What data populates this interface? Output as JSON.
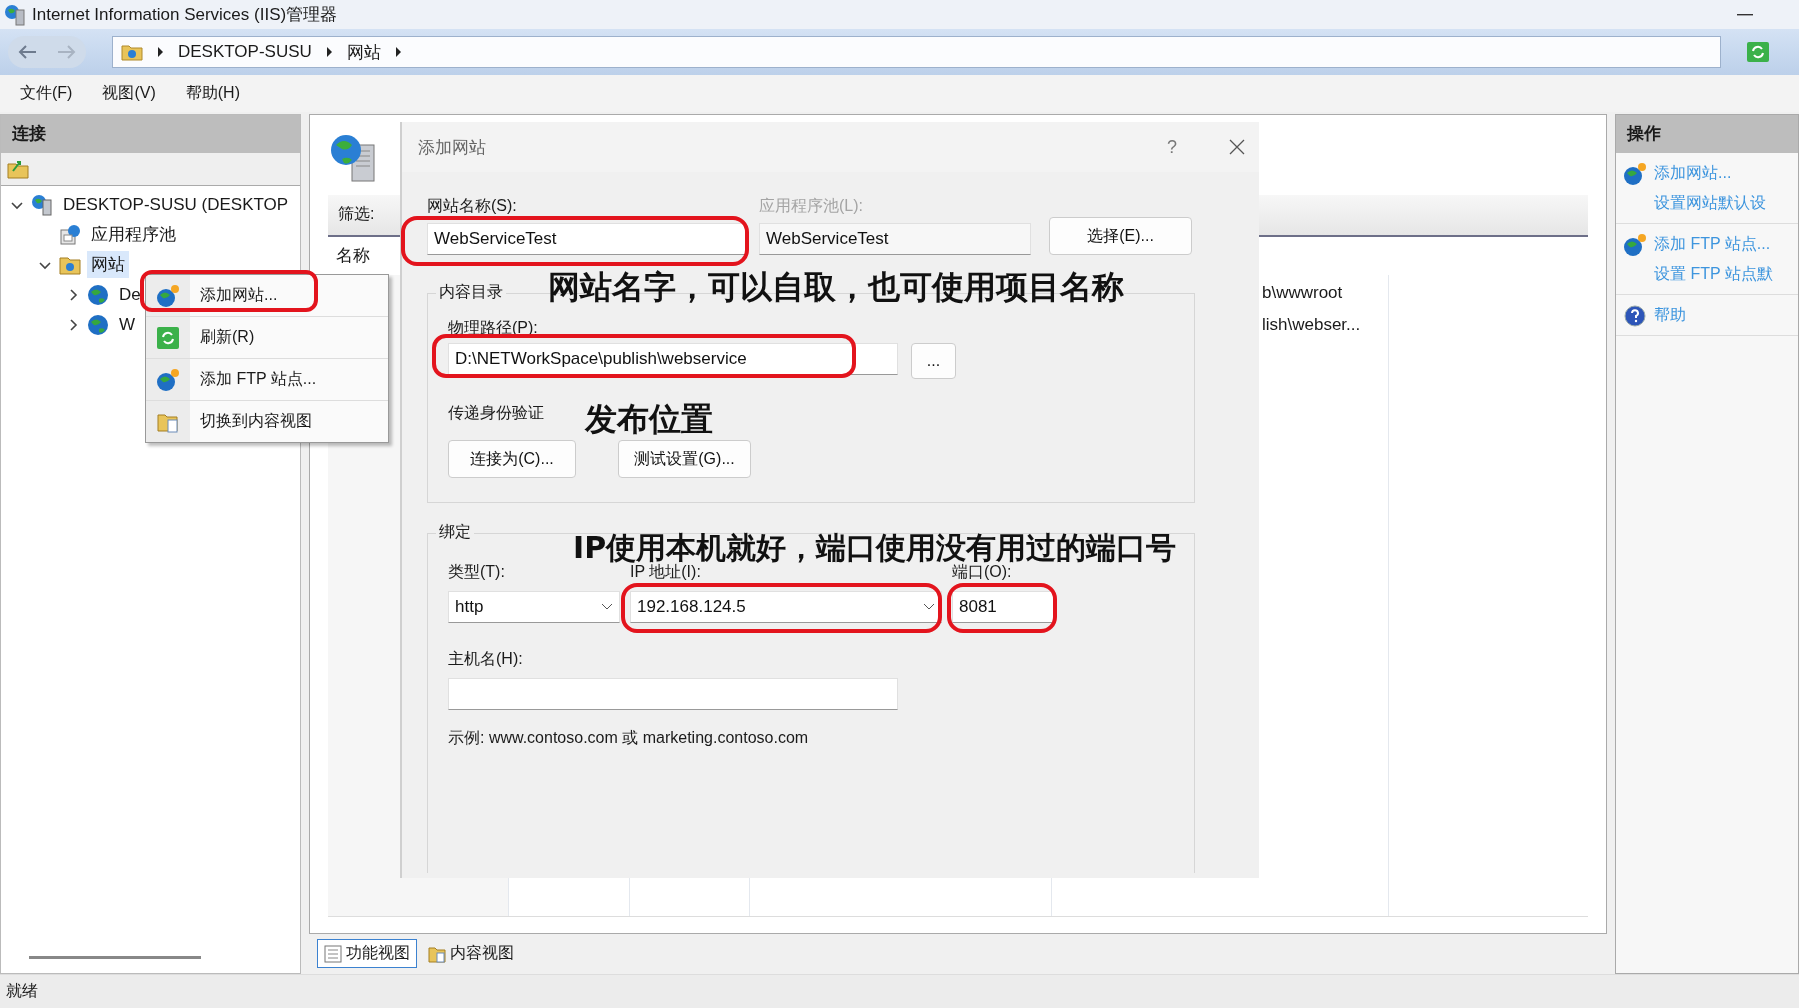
{
  "window": {
    "title": "Internet Information Services (IIS)管理器"
  },
  "breadcrumb": [
    "DESKTOP-SUSU",
    "网站"
  ],
  "menu": [
    "文件(F)",
    "视图(V)",
    "帮助(H)"
  ],
  "connections": {
    "title": "连接",
    "tree": [
      {
        "label": "DESKTOP-SUSU (DESKTOP",
        "kind": "server",
        "expanded": true,
        "selected": false,
        "children": [
          {
            "label": "应用程序池",
            "kind": "pool",
            "selected": false
          },
          {
            "label": "网站",
            "kind": "sites",
            "expanded": true,
            "selected": true,
            "children": [
              {
                "label": "De",
                "kind": "site",
                "expanded": false,
                "selected": false
              },
              {
                "label": "W",
                "kind": "site",
                "expanded": false,
                "selected": false
              }
            ]
          }
        ]
      }
    ]
  },
  "content": {
    "filter_label": "筛选:",
    "column_header": "名称",
    "rows": [
      {
        "path": "b\\wwwroot"
      },
      {
        "path": "lish\\webser..."
      }
    ],
    "views": [
      {
        "label": "功能视图",
        "selected": true
      },
      {
        "label": "内容视图",
        "selected": false
      }
    ]
  },
  "context_menu": [
    {
      "label": "添加网站...",
      "kind": "add"
    },
    {
      "label": "刷新(R)",
      "kind": "refresh"
    },
    {
      "label": "添加 FTP 站点...",
      "kind": "add"
    },
    {
      "label": "切换到内容视图",
      "kind": "view"
    }
  ],
  "actions": {
    "title": "操作",
    "groups": [
      [
        {
          "label": "添加网站...",
          "kind": "add"
        },
        {
          "label": "设置网站默认设",
          "kind": "plain"
        }
      ],
      [
        {
          "label": "添加 FTP 站点...",
          "kind": "add"
        },
        {
          "label": "设置 FTP 站点默",
          "kind": "plain"
        }
      ],
      [
        {
          "label": "帮助",
          "kind": "help"
        }
      ]
    ]
  },
  "dialog": {
    "title": "添加网站",
    "help": "?",
    "site_name": {
      "label": "网站名称(S):",
      "value": "WebServiceTest"
    },
    "app_pool": {
      "label": "应用程序池(L):",
      "value": "WebServiceTest",
      "disabled": true
    },
    "select_button": "选择(E)...",
    "content_dir": {
      "legend": "内容目录",
      "path_label": "物理路径(P):",
      "path_value": "D:\\NETWorkSpace\\publish\\webservice",
      "browse_button": "...",
      "auth_label": "传递身份验证",
      "buttons": [
        "连接为(C)...",
        "测试设置(G)..."
      ]
    },
    "binding": {
      "legend": "绑定",
      "type_label": "类型(T):",
      "type_value": "http",
      "ip_label": "IP 地址(I):",
      "ip_value": "192.168.124.5",
      "port_label": "端口(O):",
      "port_value": "8081",
      "host_label": "主机名(H):",
      "example": "示例: www.contoso.com 或 marketing.contoso.com"
    }
  },
  "annotations": [
    "网站名字，可以自取，也可使用项目名称",
    "发布位置",
    "IP使用本机就好，端口使用没有用过的端口号"
  ],
  "status_bar": "就绪"
}
